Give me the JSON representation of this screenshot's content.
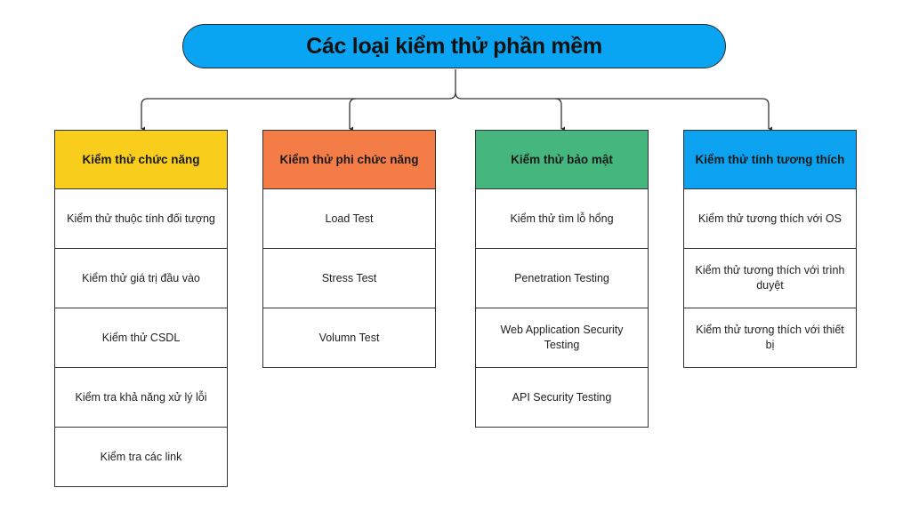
{
  "title": "Các loại kiểm thử phần mềm",
  "colors": {
    "title_bg": "#0aa5f2",
    "connector": "#333333"
  },
  "columns": [
    {
      "header": "Kiểm thử chức năng",
      "color": "#f9cd1c",
      "items": [
        "Kiểm thử thuộc tính đối tượng",
        "Kiểm thử giá trị đầu vào",
        "Kiểm thử CSDL",
        "Kiểm tra khả năng xử lý lỗi",
        "Kiểm tra các link"
      ]
    },
    {
      "header": "Kiểm thử phi chức năng",
      "color": "#f47c46",
      "items": [
        "Load Test",
        "Stress Test",
        "Volumn Test"
      ]
    },
    {
      "header": "Kiểm thử bảo mật",
      "color": "#45b67e",
      "items": [
        "Kiểm thử tìm lỗ hổng",
        "Penetration Testing",
        "Web Application Security Testing",
        "API Security Testing"
      ]
    },
    {
      "header": "Kiểm thử tính tương thích",
      "color": "#0ca2f0",
      "items": [
        "Kiểm thử tương thích với OS",
        "Kiểm thử tương thích với trình duyệt",
        "Kiểm thử tương thích với thiết bị"
      ]
    }
  ]
}
